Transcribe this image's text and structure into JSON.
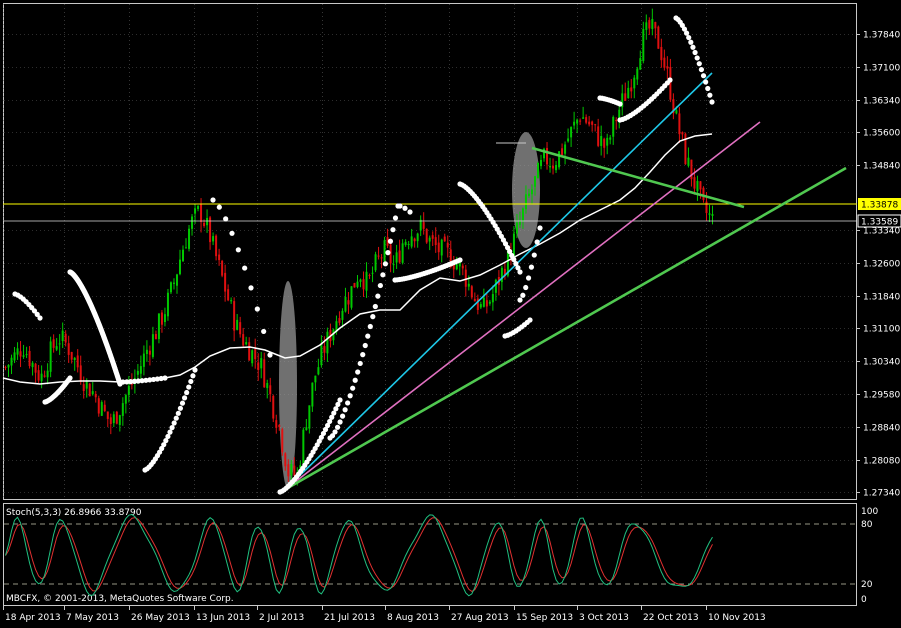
{
  "theme": {
    "background": "#000000",
    "frame": "#c8c8c8",
    "grid": "#5a5a5a",
    "bull_candle": "#00c800",
    "bear_candle": "#e01010",
    "ma_color": "#ffffff",
    "psar_color": "#ffffff",
    "price_line": "#ffff00",
    "stoch_main": "#20c080",
    "stoch_signal": "#e03030",
    "trend_cyan": "#1ec8e8",
    "trend_pink": "#e070c0",
    "trend_green": "#50c850",
    "highlight": "#a0a0a0"
  },
  "price_panel": {
    "y_ticks": [
      "1.37840",
      "1.37100",
      "1.36340",
      "1.35600",
      "1.34840",
      "1.33340",
      "1.32600",
      "1.31840",
      "1.31100",
      "1.30340",
      "1.29580",
      "1.28840",
      "1.28080",
      "1.27340"
    ],
    "current_price_label": "1.33589",
    "level_label": "1.33878"
  },
  "stoch_panel": {
    "title": "Stoch(5,3,3) 26.8966 33.8790",
    "y_ticks": [
      "100",
      "80",
      "20",
      "0"
    ],
    "copyright": "MBCFX, © 2001-2013, MetaQuotes Software Corp."
  },
  "x_axis": {
    "labels": [
      "18 Apr 2013",
      "7 May 2013",
      "26 May 2013",
      "13 Jun 2013",
      "2 Jul 2013",
      "21 Jul 2013",
      "8 Aug 2013",
      "27 Aug 2013",
      "15 Sep 2013",
      "3 Oct 2013",
      "22 Oct 2013",
      "10 Nov 2013"
    ]
  },
  "chart_data": {
    "type": "candlestick",
    "symbol_period": "",
    "ylim": [
      1.272,
      1.384
    ],
    "x_categories": [
      "18 Apr 2013",
      "7 May 2013",
      "26 May 2013",
      "13 Jun 2013",
      "2 Jul 2013",
      "21 Jul 2013",
      "8 Aug 2013",
      "27 Aug 2013",
      "15 Sep 2013",
      "3 Oct 2013",
      "22 Oct 2013",
      "10 Nov 2013"
    ],
    "close_path": [
      1.302,
      1.3045,
      1.307,
      1.303,
      1.2995,
      1.305,
      1.309,
      1.307,
      1.303,
      1.2985,
      1.296,
      1.292,
      1.289,
      1.293,
      1.297,
      1.301,
      1.306,
      1.31,
      1.315,
      1.321,
      1.329,
      1.335,
      1.338,
      1.333,
      1.326,
      1.319,
      1.312,
      1.308,
      1.305,
      1.302,
      1.295,
      1.288,
      1.278,
      1.277,
      1.29,
      1.3,
      1.306,
      1.311,
      1.316,
      1.319,
      1.324,
      1.321,
      1.326,
      1.329,
      1.325,
      1.331,
      1.333,
      1.334,
      1.331,
      1.329,
      1.328,
      1.326,
      1.323,
      1.318,
      1.315,
      1.318,
      1.323,
      1.328,
      1.334,
      1.34,
      1.345,
      1.35,
      1.349,
      1.352,
      1.356,
      1.36,
      1.358,
      1.355,
      1.352,
      1.359,
      1.364,
      1.369,
      1.377,
      1.38,
      1.376,
      1.368,
      1.358,
      1.35,
      1.344,
      1.338,
      1.3359
    ]
  }
}
